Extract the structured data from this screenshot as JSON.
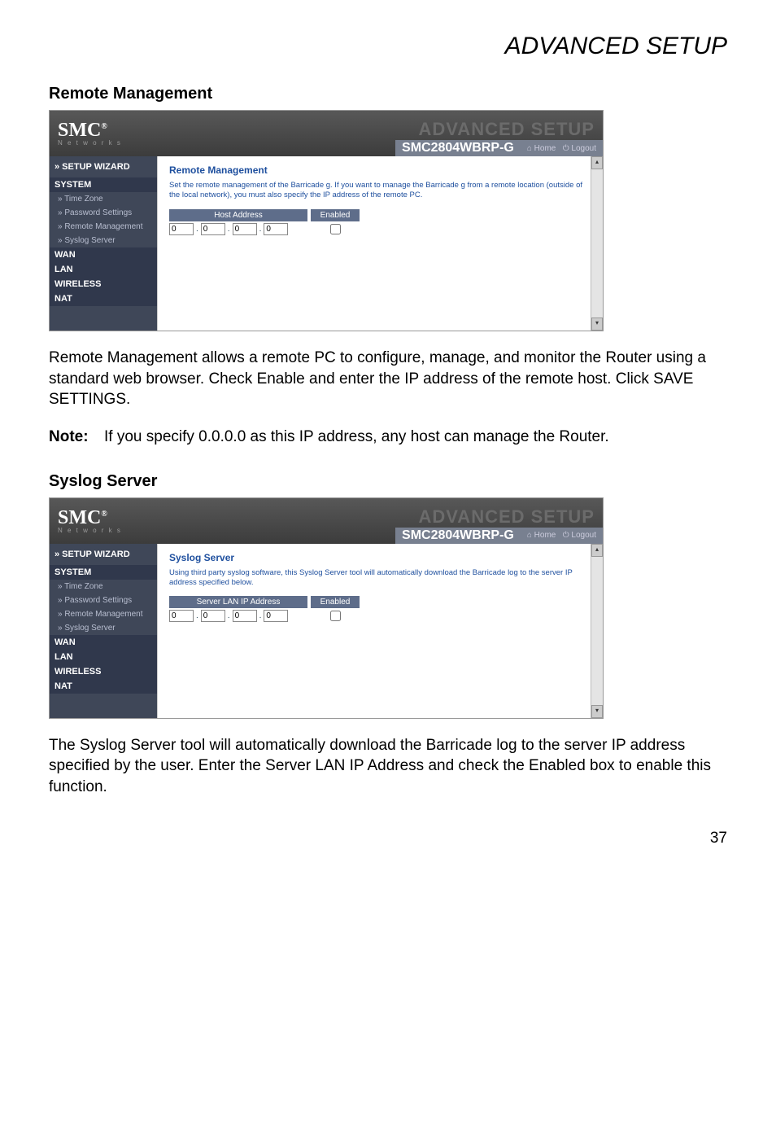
{
  "page": {
    "title": "ADVANCED SETUP",
    "number": "37"
  },
  "section1": {
    "heading": "Remote Management",
    "para": "Remote Management allows a remote PC to configure, manage, and monitor the Router using a standard web browser. Check Enable and enter the IP address of the remote host. Click SAVE SETTINGS.",
    "note_label": "Note:",
    "note_text": "If you specify 0.0.0.0 as this IP address, any host can manage the Router."
  },
  "section2": {
    "heading": "Syslog Server",
    "para": "The Syslog Server tool will automatically download the Barricade log to the server IP address specified by the user. Enter the Server LAN IP Address and check the Enabled box to enable this function."
  },
  "ui_common": {
    "logo": "SMC",
    "logo_sub": "N e t w o r k s",
    "ghost": "ADVANCED SETUP",
    "model": "SMC2804WBRP-G",
    "link_home": "Home",
    "link_logout": "Logout",
    "nav": {
      "setup_wizard": "» SETUP WIZARD",
      "system": "SYSTEM",
      "time_zone": "» Time Zone",
      "password": "» Password Settings",
      "remote": "» Remote Management",
      "syslog": "» Syslog Server",
      "wan": "WAN",
      "lan": "LAN",
      "wireless": "WIRELESS",
      "nat": "NAT"
    }
  },
  "ui1": {
    "title": "Remote Management",
    "desc": "Set the remote management of the Barricade g. If you want to manage the Barricade g from a remote location (outside of the local network), you must also specify the IP address of the remote PC.",
    "host_hdr": "Host Address",
    "enabled_hdr": "Enabled",
    "ip": [
      "0",
      "0",
      "0",
      "0"
    ]
  },
  "ui2": {
    "title": "Syslog Server",
    "desc": "Using third party syslog software, this Syslog Server tool will automatically download the Barricade log to the server IP address specified below.",
    "host_hdr": "Server LAN IP Address",
    "enabled_hdr": "Enabled",
    "ip": [
      "0",
      "0",
      "0",
      "0"
    ]
  }
}
